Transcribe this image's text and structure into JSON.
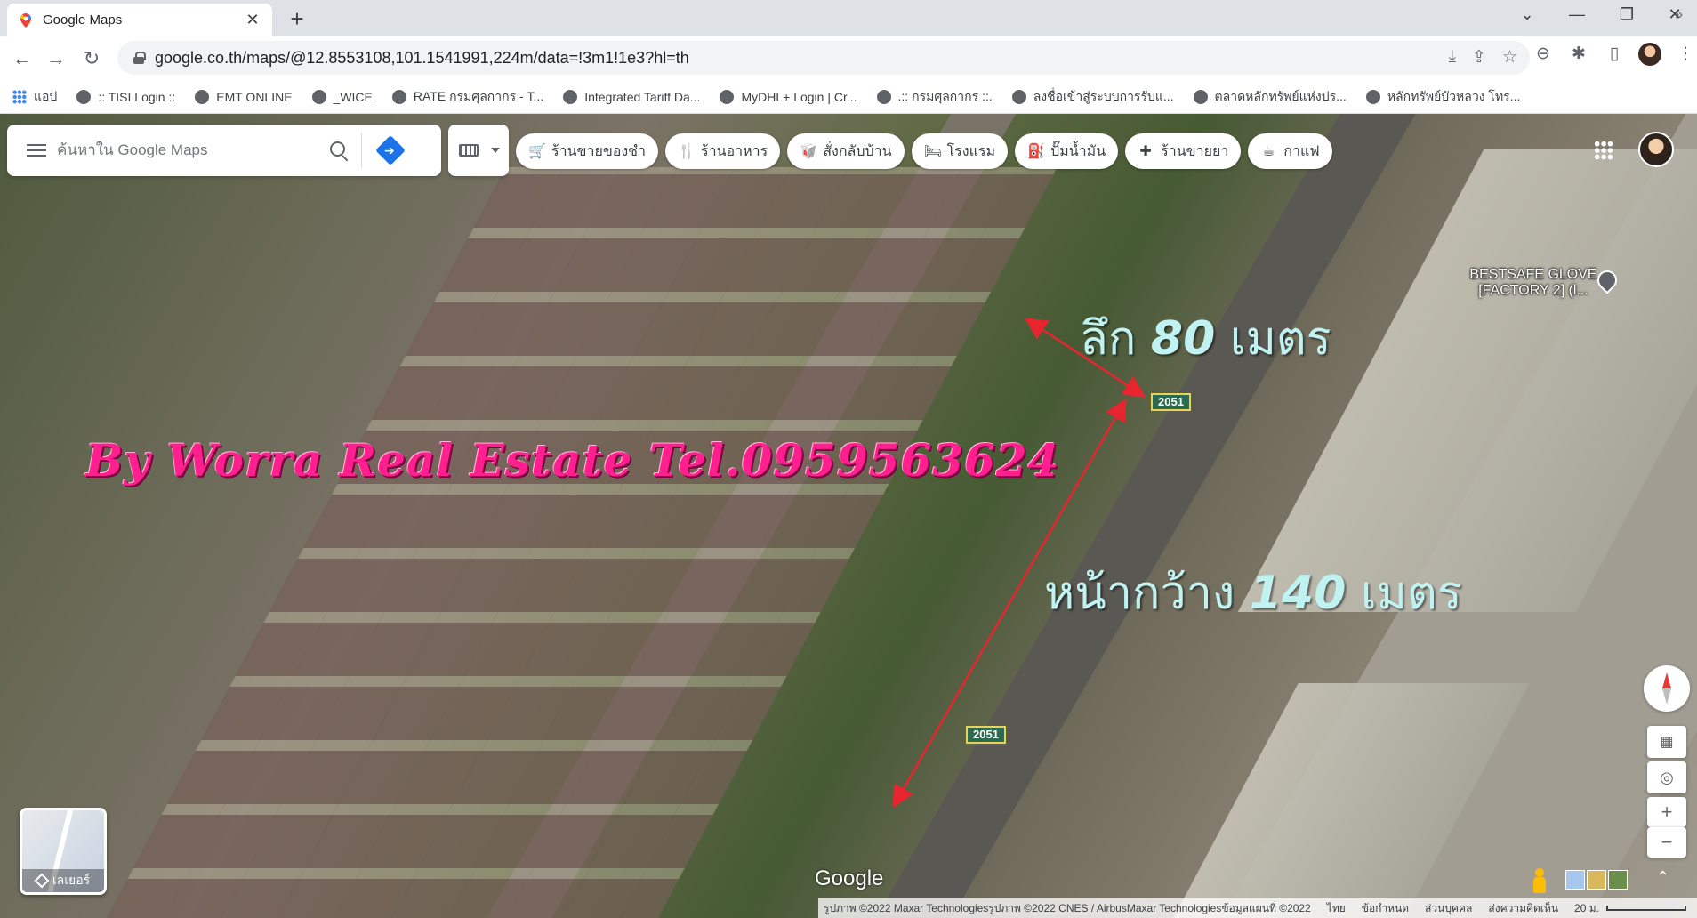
{
  "browser": {
    "tab_title": "Google Maps",
    "new_tab_label": "+",
    "url": "google.co.th/maps/@12.8553108,101.1541991,224m/data=!3m1!1e3?hl=th",
    "bookmarks": [
      "แอป",
      ":: TISI Login ::",
      "EMT ONLINE",
      "_WICE",
      "RATE กรมศุลกากร - T...",
      "Integrated Tariff Da...",
      "MyDHL+ Login | Cr...",
      ".:: กรมศุลกากร ::.",
      "ลงชื่อเข้าสู่ระบบการรับแ...",
      "ตลาดหลักทรัพย์แห่งปร...",
      "หลักทรัพย์บัวหลวง โทร..."
    ],
    "bookmarks_more": "»"
  },
  "maps": {
    "search_placeholder": "ค้นหาใน Google Maps",
    "chips": [
      {
        "icon": "cart-icon",
        "glyph": "🛒",
        "label": "ร้านขายของชำ"
      },
      {
        "icon": "restaurant-icon",
        "glyph": "🍴",
        "label": "ร้านอาหาร"
      },
      {
        "icon": "takeout-icon",
        "glyph": "🥡",
        "label": "สั่งกลับบ้าน"
      },
      {
        "icon": "hotel-icon",
        "glyph": "🛏",
        "label": "โรงแรม"
      },
      {
        "icon": "gas-station-icon",
        "glyph": "⛽",
        "label": "ปั๊มน้ำมัน"
      },
      {
        "icon": "pharmacy-icon",
        "glyph": "✚",
        "label": "ร้านขายยา"
      },
      {
        "icon": "coffee-icon",
        "glyph": "☕",
        "label": "กาแฟ"
      }
    ],
    "watermark": "By Worra Real Estate Tel.0959563624",
    "depth_label": {
      "prefix": "ลึก ",
      "number": "80",
      "suffix": " เมตร"
    },
    "width_label": {
      "prefix": "หน้ากว้าง ",
      "number": "140",
      "suffix": " เมตร"
    },
    "road_number": "2051",
    "place_name": "BESTSAFE GLOVE [FACTORY 2] (l...",
    "layers_label": "เลเยอร์",
    "google_logo": "Google",
    "attribution": [
      "รูปภาพ ©2022 Maxar Technologiesรูปภาพ ©2022 CNES / AirbusMaxar Technologiesข้อมูลแผนที่ ©2022",
      "ไทย",
      "ข้อกำหนด",
      "ส่วนบุคคล",
      "ส่งความคิดเห็น",
      "20 ม."
    ],
    "zoom_in": "+",
    "zoom_out": "−"
  },
  "colors": {
    "watermark": "#ff1f8e",
    "measure_text": "#bff2f0",
    "measure_line": "#e8252f",
    "directions": "#1a73e8"
  }
}
